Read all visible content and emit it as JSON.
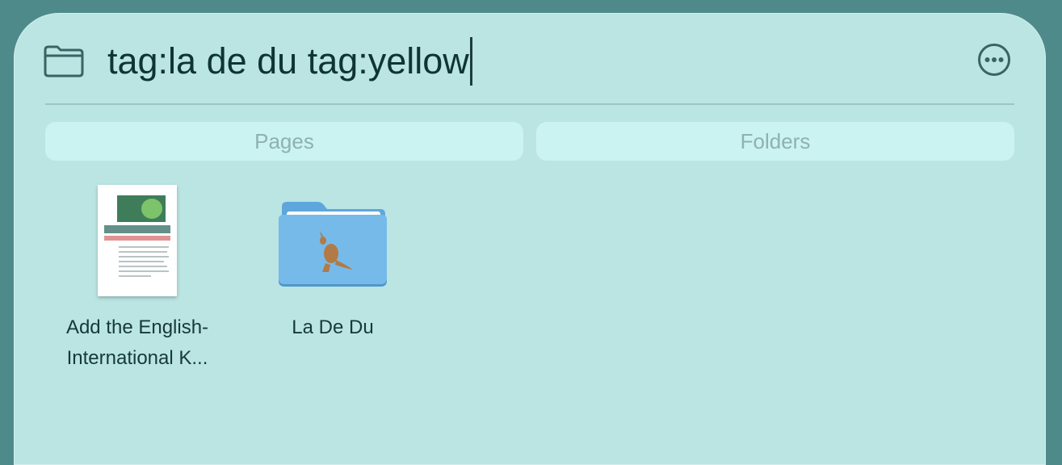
{
  "search": {
    "query": "tag:la de du tag:yellow"
  },
  "toolbar": {
    "folder_icon": "folder-outline-icon",
    "more_icon": "ellipsis-circle-icon"
  },
  "tabs": [
    {
      "label": "Pages"
    },
    {
      "label": "Folders"
    }
  ],
  "results": [
    {
      "label_line1": "Add the English-",
      "label_line2": "International K...",
      "icon": "document-thumbnail"
    },
    {
      "label_line1": "La De Du",
      "icon": "kangaroo-folder-icon"
    }
  ],
  "colors": {
    "panel": "#bae5e3",
    "tab": "#cbf3f1",
    "background": "#4f8a8b",
    "folder": "#6fb3e6"
  }
}
